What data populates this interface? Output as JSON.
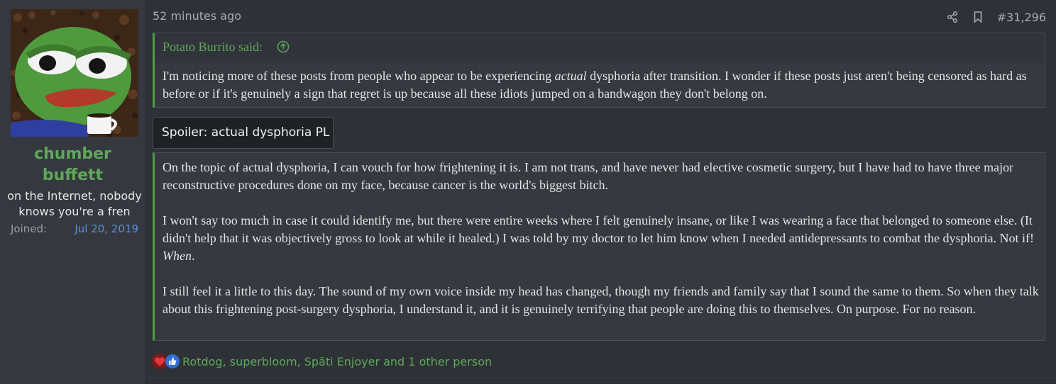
{
  "user": {
    "name_line1": "chumber",
    "name_line2": "buffett",
    "title_line1": "on the Internet, nobody",
    "title_line2": "knows you're a fren",
    "joined_label": "Joined:",
    "joined_date": "Jul 20, 2019"
  },
  "meta": {
    "time": "52 minutes ago",
    "post_number": "#31,296",
    "share_icon": "share-icon",
    "bookmark_icon": "bookmark-icon"
  },
  "quote": {
    "author": "Potato Burrito said:",
    "text_a": "I'm noticing more of these posts from people who appear to be experiencing ",
    "text_em": "actual",
    "text_b": " dysphoria after transition. I wonder if these posts just aren't being censored as hard as before or if it's genuinely a sign that regret is up because all these idiots jumped on a bandwagon they don't belong on."
  },
  "spoiler": {
    "label": "Spoiler: actual dysphoria PL"
  },
  "body": {
    "p1": "On the topic of actual dysphoria, I can vouch for how frightening it is. I am not trans, and have never had elective cosmetic surgery, but I have had to have three major reconstructive procedures done on my face, because cancer is the world's biggest bitch.",
    "p2a": "I won't say too much in case it could identify me, but there were entire weeks where I felt genuinely insane, or like I was wearing a face that belonged to someone else. (It didn't help that it was objectively gross to look at while it healed.) I was told by my doctor to let him know when I needed antidepressants to combat the dysphoria. Not if! ",
    "p2em": "When",
    "p2b": ".",
    "p3": "I still feel it a little to this day. The sound of my own voice inside my head has changed, though my friends and family say that I sound the same to them. So when they talk about this frightening post-surgery dysphoria, I understand it, and it is genuinely terrifying that people are doing this to themselves. On purpose. For no reason."
  },
  "reactions": {
    "icons": [
      "heart-icon",
      "thumbs-up-icon"
    ],
    "text": "Rotdog, superbloom, Späti Enjoyer and 1 other person"
  },
  "colors": {
    "accent_green": "#5ea85a",
    "link_blue": "#5b8fd6",
    "background": "#2e3136"
  }
}
